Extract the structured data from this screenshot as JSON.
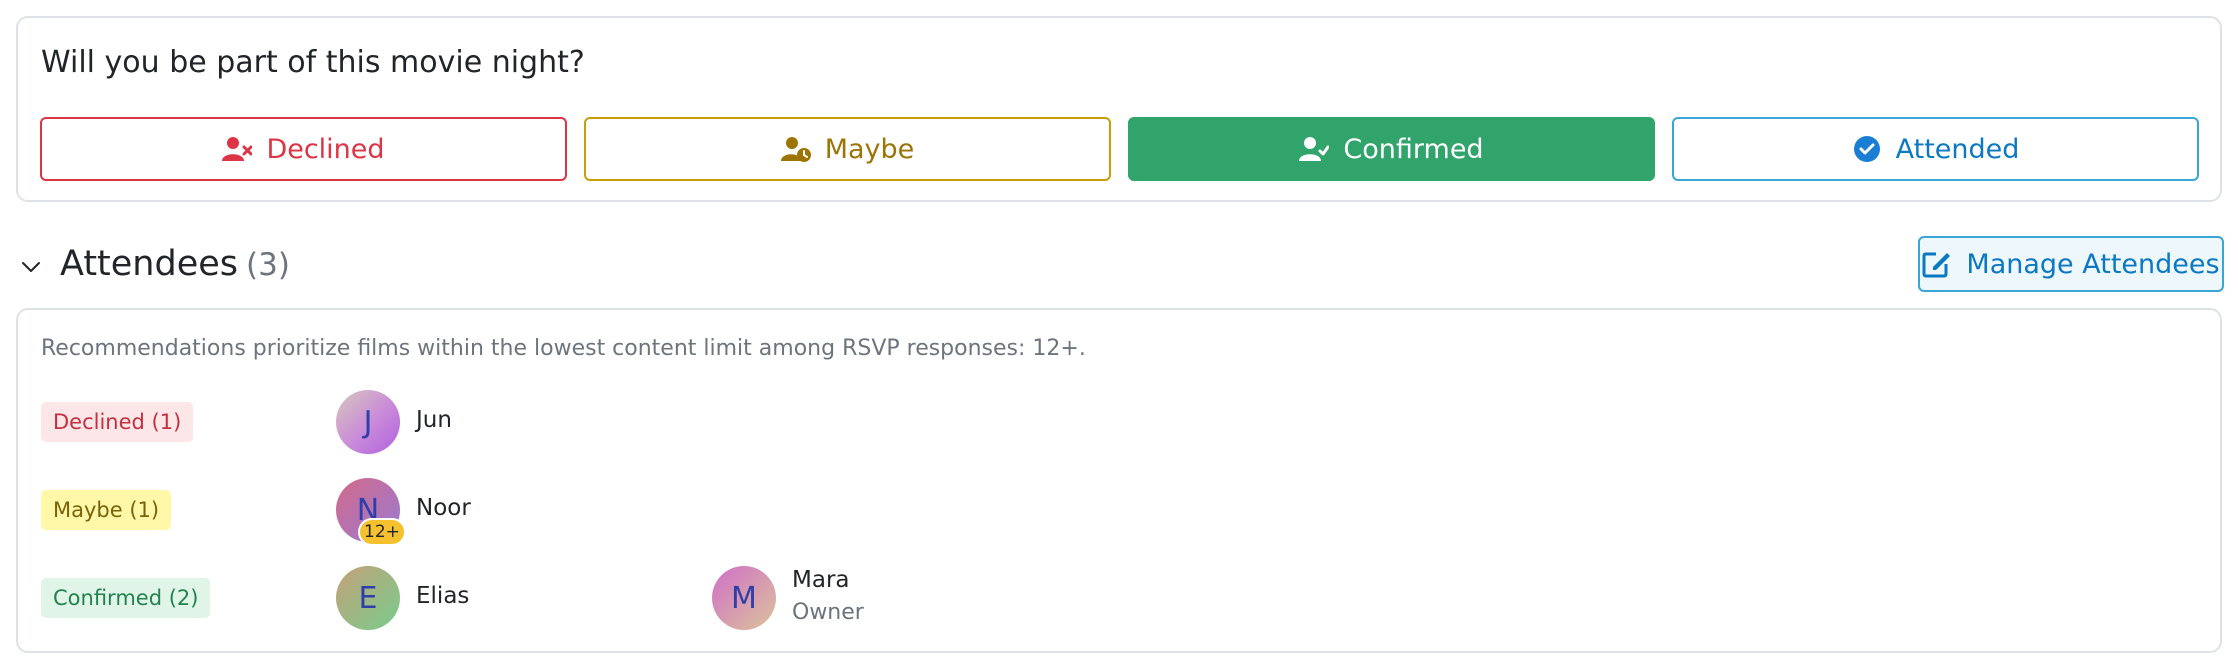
{
  "rsvp": {
    "question": "Will you be part of this movie night?",
    "options": [
      {
        "label": "Declined",
        "icon": "user-x-icon",
        "color": "#dc3545"
      },
      {
        "label": "Maybe",
        "icon": "user-clock-icon",
        "color": "#c99c0b"
      },
      {
        "label": "Confirmed",
        "icon": "user-check-icon",
        "color": "#31a46c",
        "selected": true
      },
      {
        "label": "Attended",
        "icon": "check-circle-icon",
        "color": "#3aa6d8"
      }
    ]
  },
  "attendees": {
    "title": "Attendees",
    "count": "(3)",
    "manage_label": "Manage Attendees",
    "note": "Recommendations prioritize films within the lowest content limit among RSVP responses: 12+.",
    "groups": [
      {
        "badge": "Declined (1)",
        "people": [
          {
            "initial": "J",
            "name": "Jun"
          }
        ]
      },
      {
        "badge": "Maybe (1)",
        "people": [
          {
            "initial": "N",
            "name": "Noor",
            "age_limit": "12+"
          }
        ]
      },
      {
        "badge": "Confirmed (2)",
        "people": [
          {
            "initial": "E",
            "name": "Elias"
          },
          {
            "initial": "M",
            "name": "Mara",
            "role": "Owner"
          }
        ]
      }
    ]
  }
}
